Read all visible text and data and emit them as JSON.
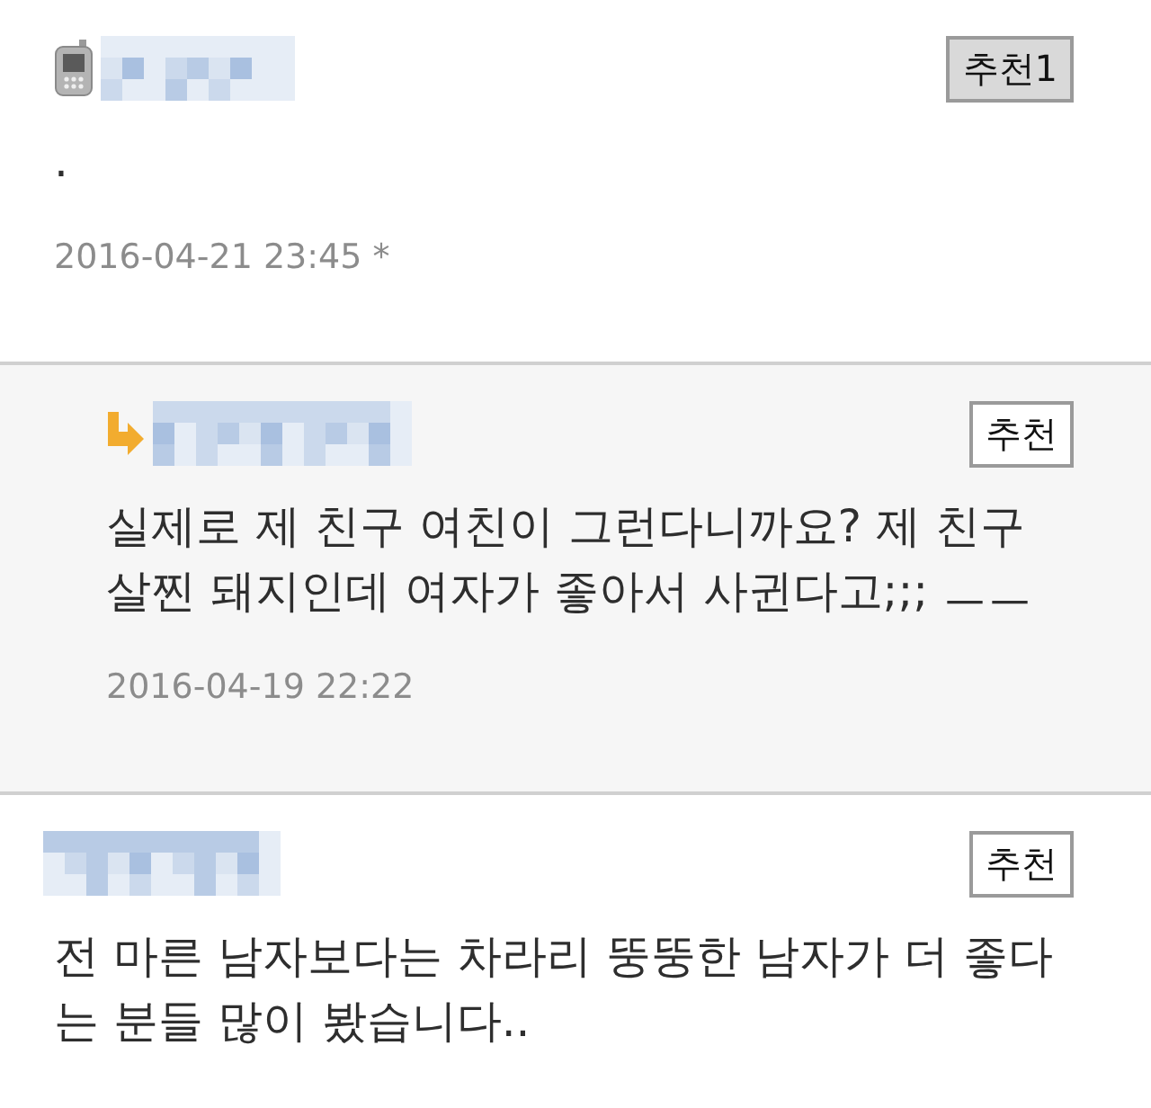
{
  "comments": [
    {
      "kind": "comment",
      "mobile": true,
      "vote_button": {
        "label": "추천",
        "count": "1",
        "filled": true
      },
      "body": ".",
      "date": "2016-04-21 23:45 *"
    },
    {
      "kind": "reply",
      "mobile": false,
      "vote_button": {
        "label": "추천",
        "filled": false
      },
      "body": "실제로 제 친구 여친이 그런다니까요? 제 친구 살찐 돼지인데 여자가 좋아서 사귄다고;;; ㅡㅡ",
      "date": "2016-04-19 22:22"
    },
    {
      "kind": "comment",
      "mobile": false,
      "vote_button": {
        "label": "추천",
        "filled": false
      },
      "body": "전 마른 남자보다는 차라리 뚱뚱한 남자가 더 좋다는 분들 많이 봤습니다.."
    }
  ]
}
